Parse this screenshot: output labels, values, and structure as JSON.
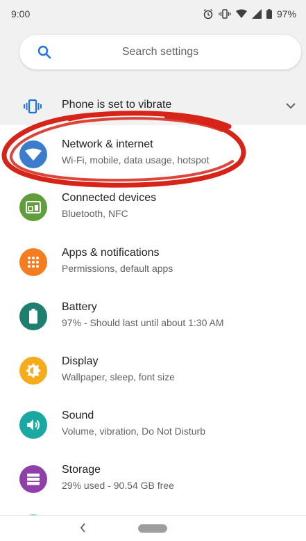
{
  "status_bar": {
    "time": "9:00",
    "battery": "97%"
  },
  "search": {
    "placeholder": "Search settings"
  },
  "suggestion": {
    "text": "Phone is set to vibrate"
  },
  "items": [
    {
      "title": "Network & internet",
      "subtitle": "Wi-Fi, mobile, data usage, hotspot",
      "icon": "wifi-icon",
      "color": "#3b7ccc"
    },
    {
      "title": "Connected devices",
      "subtitle": "Bluetooth, NFC",
      "icon": "connected-devices-icon",
      "color": "#5f9e3a"
    },
    {
      "title": "Apps & notifications",
      "subtitle": "Permissions, default apps",
      "icon": "apps-grid-icon",
      "color": "#f57c1f"
    },
    {
      "title": "Battery",
      "subtitle": "97% - Should last until about 1:30 AM",
      "icon": "battery-icon",
      "color": "#1f7f6e"
    },
    {
      "title": "Display",
      "subtitle": "Wallpaper, sleep, font size",
      "icon": "brightness-icon",
      "color": "#f6ab1b"
    },
    {
      "title": "Sound",
      "subtitle": "Volume, vibration, Do Not Disturb",
      "icon": "volume-icon",
      "color": "#19a9a2"
    },
    {
      "title": "Storage",
      "subtitle": "29% used - 90.54 GB free",
      "icon": "storage-icon",
      "color": "#8e3fa8"
    }
  ],
  "annotation": {
    "color": "#d62418"
  }
}
